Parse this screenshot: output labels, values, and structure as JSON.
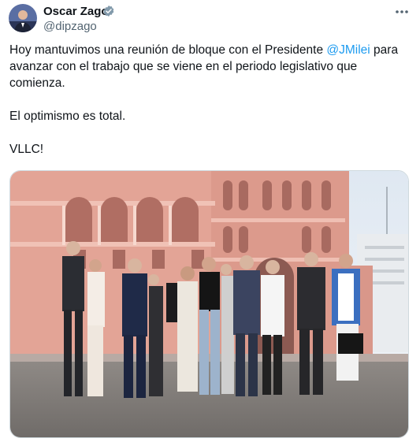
{
  "author": {
    "name": "Oscar Zago",
    "handle": "@dipzago",
    "verified": true,
    "avatar_icon": "profile-avatar"
  },
  "tweet": {
    "line1_prefix": "Hoy mantuvimos una reunión de bloque con el Presidente ",
    "mention": "@JMilei",
    "line1_suffix": " para",
    "line2": "avanzar con el trabajo que se viene en el periodo legislativo que",
    "line3": "comienza.",
    "line4": "El optimismo es total.",
    "line5": "VLLC!"
  },
  "icons": {
    "verified": "verified-badge-icon",
    "more": "more-options-icon"
  },
  "colors": {
    "accent": "#1d9bf0",
    "text": "#0f1419",
    "muted": "#536471",
    "building": "#e6a59a"
  }
}
